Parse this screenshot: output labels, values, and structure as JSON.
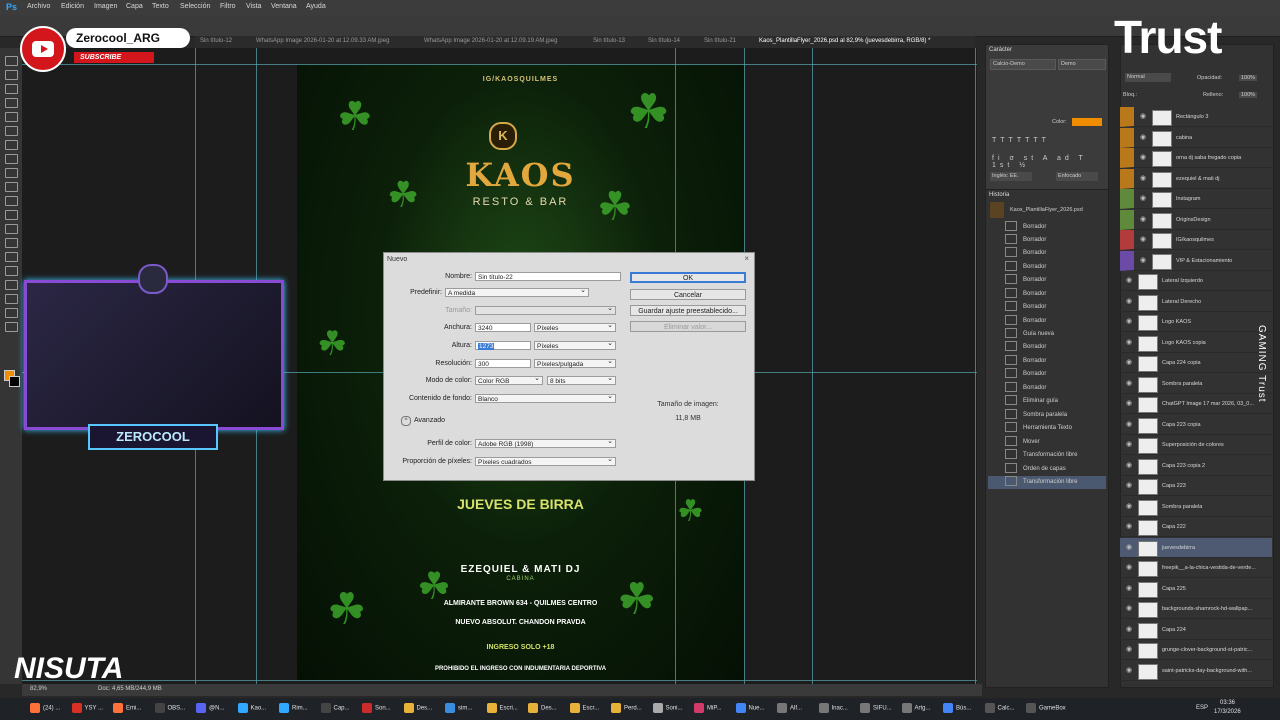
{
  "menu": [
    "Archivo",
    "Edición",
    "Imagen",
    "Capa",
    "Texto",
    "Selección",
    "Filtro",
    "Vista",
    "Ventana",
    "Ayuda"
  ],
  "tabs": [
    {
      "label": "Sin título-12"
    },
    {
      "label": "WhatsApp Image 2026-01-20 at 12.09.33 AM.jpeg"
    },
    {
      "label": "WhatsApp Image 2026-01-20 at 12.09.19 AM.jpeg"
    },
    {
      "label": "Sin título-13"
    },
    {
      "label": "Sin título-14"
    },
    {
      "label": "Sin título-21"
    },
    {
      "label": "Kaos_PlantillaFlyer_2026.psd al 82,9% (juevesdebirra, RGB/8) *"
    }
  ],
  "dialog": {
    "title": "Nuevo",
    "nombre_label": "Nombre:",
    "nombre_value": "Sin título-22",
    "predefinir_label": "Predefinir:",
    "predefinir_value": "A medida",
    "tamano_label": "Tamaño:",
    "anchura_label": "Anchura:",
    "anchura_value": "3240",
    "anchura_unit": "Píxeles",
    "altura_label": "Altura:",
    "altura_value": "1273",
    "altura_unit": "Píxeles",
    "resolucion_label": "Resolución:",
    "resolucion_value": "300",
    "resolucion_unit": "Píxeles/pulgada",
    "modo_label": "Modo de color:",
    "modo_value": "Color RGB",
    "bits_value": "8 bits",
    "fondo_label": "Contenido de fondo:",
    "fondo_value": "Blanco",
    "avanzado_label": "Avanzado",
    "perfil_label": "Perfil de color:",
    "perfil_value": "Adobe RGB (1998)",
    "proporcion_label": "Proporción de píxeles:",
    "proporcion_value": "Píxeles cuadrados",
    "ok": "OK",
    "cancel": "Cancelar",
    "save_preset": "Guardar ajuste preestablecido...",
    "delete_preset": "Eliminar valor...",
    "size_label": "Tamaño de imagen:",
    "size_value": "11,8 MB"
  },
  "flyer": {
    "ig": "IG/KAOSQUILMES",
    "brand": "KAOS",
    "sub": "RESTO & BAR",
    "event": "JUEVES DE BIRRA",
    "djs": "EZEQUIEL & MATI DJ",
    "cabina": "CABINA",
    "address": "ALMIRANTE BROWN 634 - QUILMES CENTRO",
    "sponsors": "NUEVO  ABSOLUT.   CHANDON  PRAVDA",
    "ingreso": "INGRESO SOLO +18",
    "prohibido": "PROHIBIDO EL INGRESO CON INDUMENTARIA DEPORTIVA"
  },
  "char_panel": {
    "title": "Carácter",
    "font": "Calcio-Demo",
    "style": "Demo",
    "color_label": "Color:",
    "lang": "Inglés: EE.",
    "aa": "Enfocado"
  },
  "history": {
    "title": "Historia",
    "snapshot": "Kaos_PlantillaFlyer_2026.psd",
    "items": [
      "Borrador",
      "Borrador",
      "Borrador",
      "Borrador",
      "Borrador",
      "Borrador",
      "Borrador",
      "Borrador",
      "Guía nueva",
      "Borrador",
      "Borrador",
      "Borrador",
      "Borrador",
      "Eliminar guía",
      "Sombra paralela",
      "Herramienta Texto",
      "Mover",
      "Transformación libre",
      "Orden de capas",
      "Transformación libre"
    ]
  },
  "layers": {
    "mode": "Normal",
    "opacity_label": "Opacidad:",
    "opacity": "100%",
    "fill_label": "Relleno:",
    "fill": "100%",
    "lock_label": "Bloq.:",
    "rows": [
      {
        "name": "Rectángulo 3",
        "tint": "orange"
      },
      {
        "name": "cabina",
        "tint": "orange"
      },
      {
        "name": "orna dj saba fregado copia",
        "tint": "orange"
      },
      {
        "name": "ezequiel & mati dj",
        "tint": "orange"
      },
      {
        "name": "Instagram",
        "tint": "green"
      },
      {
        "name": "OriginsDesign",
        "tint": "green"
      },
      {
        "name": "IG/kaosquilmes",
        "tint": "red"
      },
      {
        "name": "VIP & Estacionamiento",
        "tint": "purple"
      },
      {
        "name": "Lateral Izquierdo",
        "tint": ""
      },
      {
        "name": "Lateral Derecho",
        "tint": ""
      },
      {
        "name": "Logo KAOS",
        "tint": ""
      },
      {
        "name": "Logo KAOS copia",
        "tint": ""
      },
      {
        "name": "Capa 224 copia",
        "tint": ""
      },
      {
        "name": "Sombra paralela",
        "tint": ""
      },
      {
        "name": "ChatGPT Image 17 mar 2026, 03_0...",
        "tint": ""
      },
      {
        "name": "Capa 223 copia",
        "tint": ""
      },
      {
        "name": "Superposición de colores",
        "tint": ""
      },
      {
        "name": "Capa 223 copia 2",
        "tint": ""
      },
      {
        "name": "Capa 223",
        "tint": ""
      },
      {
        "name": "Sombra paralela",
        "tint": ""
      },
      {
        "name": "Capa 222",
        "tint": ""
      },
      {
        "name": "juevesdebirra",
        "tint": "",
        "selected": true
      },
      {
        "name": "freepik__a-la-chica-vestida-de-verde...",
        "tint": ""
      },
      {
        "name": "Capa 225",
        "tint": ""
      },
      {
        "name": "backgrounds-shamrock-hd-wallpap...",
        "tint": ""
      },
      {
        "name": "Capa 224",
        "tint": ""
      },
      {
        "name": "grunge-clover-background-st-patric...",
        "tint": ""
      },
      {
        "name": "saint-patricks-day-background-with...",
        "tint": ""
      }
    ]
  },
  "status": {
    "zoom": "82,9%",
    "doc": "Doc: 4,65 MB/244,9 MB"
  },
  "taskbar": {
    "items": [
      "(24) ...",
      "YSY ...",
      "Emi...",
      "OBS...",
      "@N...",
      "Kao...",
      "Rim...",
      "Cap...",
      "Son...",
      "Des...",
      "sim...",
      "Escri...",
      "Des...",
      "Escr...",
      "Perd...",
      "Soni...",
      "MiP...",
      "Nue...",
      "Alf...",
      "Inac...",
      "SIFU...",
      "Artg...",
      "Bús...",
      "Calc...",
      "GameBox"
    ],
    "lang": "ESP",
    "time": "03:36",
    "date": "17/3/2026"
  },
  "overlays": {
    "channel": "Zerocool_ARG",
    "subscribe": "SUBSCRIBE",
    "webcam_name": "ZEROCOOL",
    "trust": "Trust",
    "nisuta": "NISUTA",
    "gaming": "GAMING  Trust"
  },
  "colors": {
    "accent_orange": "#ef8c00",
    "selection_blue": "#4d5a72",
    "ps_blue": "#31a8ff"
  }
}
